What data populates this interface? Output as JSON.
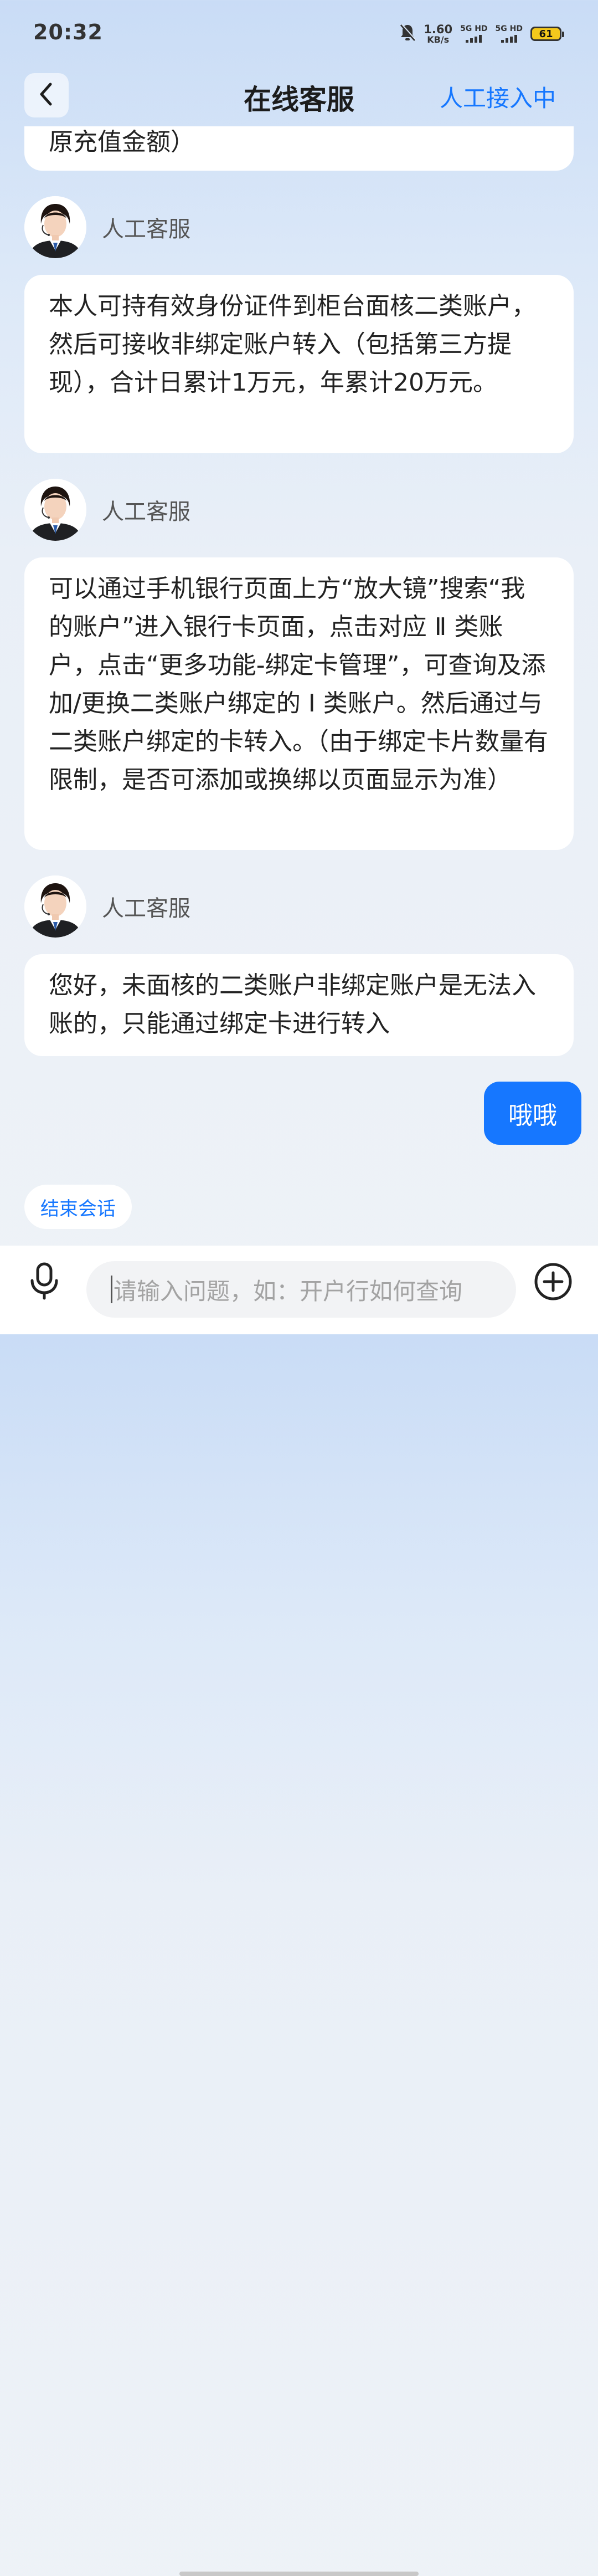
{
  "status_bar": {
    "time": "20:32",
    "net_speed_value": "1.60",
    "net_speed_unit": "KB/s",
    "sim1_label": "5G HD",
    "sim2_label": "5G HD",
    "battery": "61",
    "battery_color": "#f4c81c"
  },
  "header": {
    "title": "在线客服",
    "agent_status": "人工接入中"
  },
  "messages": [
    {
      "type": "agent_text_partial",
      "text": "原充值金额）"
    },
    {
      "type": "agent_label",
      "name": "人工客服"
    },
    {
      "type": "agent_text",
      "text": "本人可持有效身份证件到柜台面核二类账户，然后可接收非绑定账户转入（包括第三方提现），合计日累计1万元，年累计20万元。"
    },
    {
      "type": "agent_label",
      "name": "人工客服"
    },
    {
      "type": "agent_text",
      "text": "可以通过手机银行页面上方“放大镜”搜索“我的账户”进入银行卡页面，点击对应 Ⅱ 类账户，点击“更多功能-绑定卡管理”，可查询及添加/更换二类账户绑定的 Ⅰ 类账户。然后通过与二类账户绑定的卡转入。（由于绑定卡片数量有限制，是否可添加或换绑以页面显示为准）"
    },
    {
      "type": "agent_label",
      "name": "人工客服"
    },
    {
      "type": "agent_text",
      "text": "您好，未面核的二类账户非绑定账户是无法入账的，只能通过绑定卡进行转入"
    },
    {
      "type": "user_text",
      "text": "哦哦"
    }
  ],
  "end_session_label": "结束会话",
  "input": {
    "placeholder": "请输入问题，如：开户行如何查询"
  },
  "colors": {
    "accent": "#1677ff",
    "bubble_bg": "#ffffff"
  },
  "icons": {
    "back": "chevron-left-icon",
    "mic": "microphone-icon",
    "add": "plus-circle-icon",
    "mute": "bell-off-icon"
  }
}
